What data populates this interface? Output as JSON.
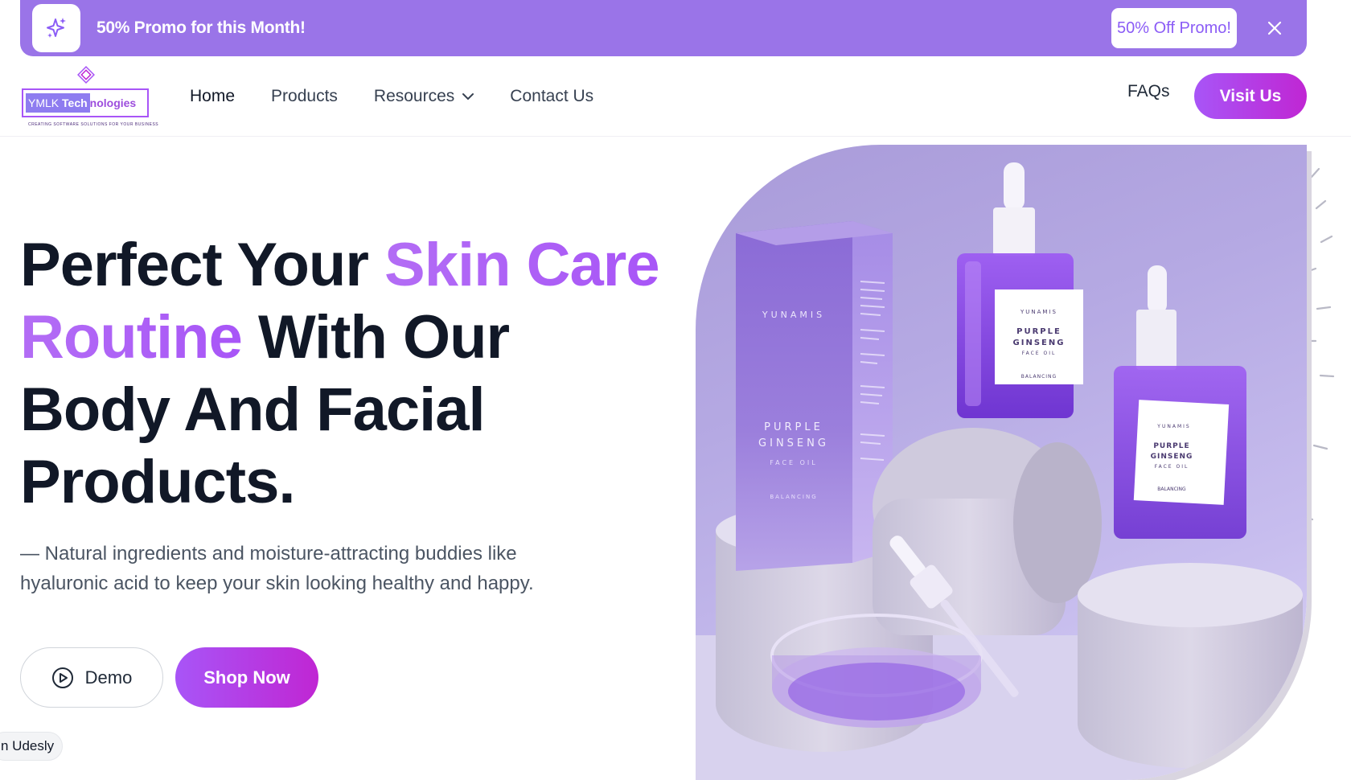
{
  "promo": {
    "text": "50% Promo for this Month!",
    "button": "50% Off Promo!",
    "icon": "sparkle-icon"
  },
  "nav": {
    "logo": {
      "brand_plain": "YMLK ",
      "brand_highlight_bold": "Tech",
      "brand_rest": "nologies",
      "tagline": "CREATING SOFTWARE SOLUTIONS FOR YOUR BUSINESS"
    },
    "links": [
      "Home",
      "Products",
      "Resources",
      "Contact Us"
    ],
    "faqs": "FAQs",
    "cta": "Visit Us"
  },
  "hero": {
    "headline_1": "Perfect Your ",
    "headline_accent_1": "Skin Care",
    "headline_accent_2": "Routine",
    "headline_2": " With Our",
    "headline_3": "Body And Facial",
    "headline_4": "Products.",
    "subtext": "— Natural ingredients and moisture-attracting buddies like hyaluronic acid to keep your skin looking healthy and happy.",
    "demo_button": "Demo",
    "shop_button": "Shop Now",
    "badge": "n Udesly"
  },
  "product": {
    "box_brand": "YUNAMIS",
    "box_name_1": "PURPLE",
    "box_name_2": "GINSENG",
    "box_type": "FACE OIL",
    "box_variant": "BALANCING",
    "bottle_brand": "YUNAMIS",
    "bottle_name_1": "PURPLE",
    "bottle_name_2": "GINSENG",
    "bottle_type": "FACE OIL",
    "bottle_variant": "BALANCING"
  },
  "colors": {
    "accent": "#a855f7",
    "promo_bg": "#9a74e8",
    "gradient_end": "#c026d3"
  }
}
